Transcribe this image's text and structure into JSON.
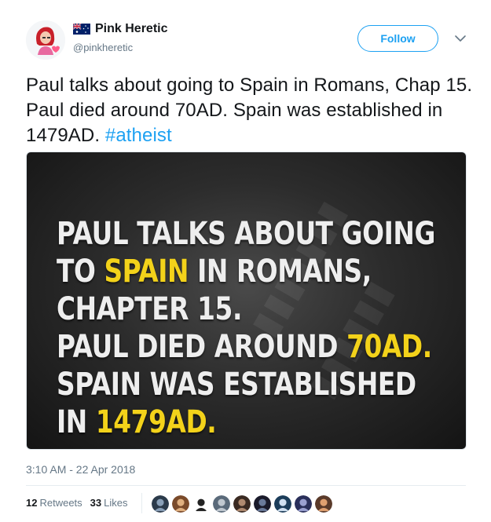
{
  "user": {
    "display_name": "Pink Heretic",
    "handle": "@pinkheretic",
    "flag_icon": "australia-flag-icon"
  },
  "follow_label": "Follow",
  "tweet": {
    "text": "Paul talks about going to Spain in Romans, Chap 15. Paul died around 70AD. Spain was established in 1479AD.",
    "hashtag": "#atheist"
  },
  "media": {
    "lines": [
      [
        {
          "t": "PAUL TALKS ABOUT GOING",
          "hl": false
        }
      ],
      [
        {
          "t": "TO ",
          "hl": false
        },
        {
          "t": "SPAIN",
          "hl": true
        },
        {
          "t": " IN ROMANS,",
          "hl": false
        }
      ],
      [
        {
          "t": "CHAPTER 15.",
          "hl": false
        }
      ],
      [
        {
          "t": "PAUL DIED AROUND ",
          "hl": false
        },
        {
          "t": "70AD.",
          "hl": true
        }
      ],
      [
        {
          "t": "SPAIN WAS ESTABLISHED",
          "hl": false
        }
      ],
      [
        {
          "t": "IN ",
          "hl": false
        },
        {
          "t": "1479AD.",
          "hl": true
        }
      ]
    ],
    "highlight_color": "#f3d21a"
  },
  "timestamp": "3:10 AM - 22 Apr 2018",
  "stats": {
    "retweets_count": "12",
    "retweets_label": "Retweets",
    "likes_count": "33",
    "likes_label": "Likes"
  },
  "likers": [
    {
      "color": "#2b3a4a",
      "accent": "#8aa0b8"
    },
    {
      "color": "#7a4a2a",
      "accent": "#e0b080"
    },
    {
      "color": "#ffffff",
      "accent": "#222222"
    },
    {
      "color": "#5a6a7a",
      "accent": "#c0c8d0"
    },
    {
      "color": "#3a2a22",
      "accent": "#b08a70"
    },
    {
      "color": "#1a1a2a",
      "accent": "#6a7a9a"
    },
    {
      "color": "#1c3d5a",
      "accent": "#d0e0f0"
    },
    {
      "color": "#2a2f5a",
      "accent": "#9aa0d0"
    },
    {
      "color": "#5a3a2a",
      "accent": "#e0a070"
    }
  ],
  "colors": {
    "accent": "#1da1f2",
    "secondary_text": "#657786"
  }
}
